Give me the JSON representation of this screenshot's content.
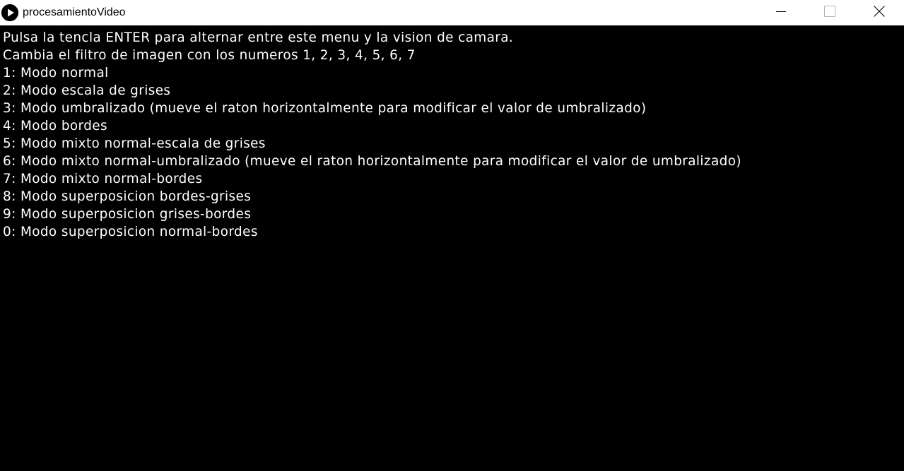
{
  "window": {
    "title": "procesamientoVideo",
    "icon": "play-circle-icon",
    "controls": {
      "minimize_icon": "minimize-icon",
      "maximize_icon": "maximize-icon",
      "close_icon": "close-icon"
    }
  },
  "colors": {
    "titlebar_bg": "#ffffff",
    "canvas_bg": "#000000",
    "text": "#ffffff"
  },
  "menu": {
    "lines": [
      "Pulsa la tencla ENTER para alternar entre este menu y la vision de camara.",
      "Cambia el filtro de imagen con los numeros 1, 2, 3, 4, 5, 6, 7",
      "1: Modo normal",
      "2: Modo escala de grises",
      "3: Modo umbralizado (mueve el raton horizontalmente para modificar el valor de umbralizado)",
      "4: Modo bordes",
      "5: Modo mixto normal-escala de grises",
      "6: Modo mixto normal-umbralizado (mueve el raton horizontalmente para modificar el valor de umbralizado)",
      "7: Modo mixto normal-bordes",
      "8: Modo superposicion bordes-grises",
      "9: Modo superposicion grises-bordes",
      "0: Modo superposicion normal-bordes"
    ]
  }
}
